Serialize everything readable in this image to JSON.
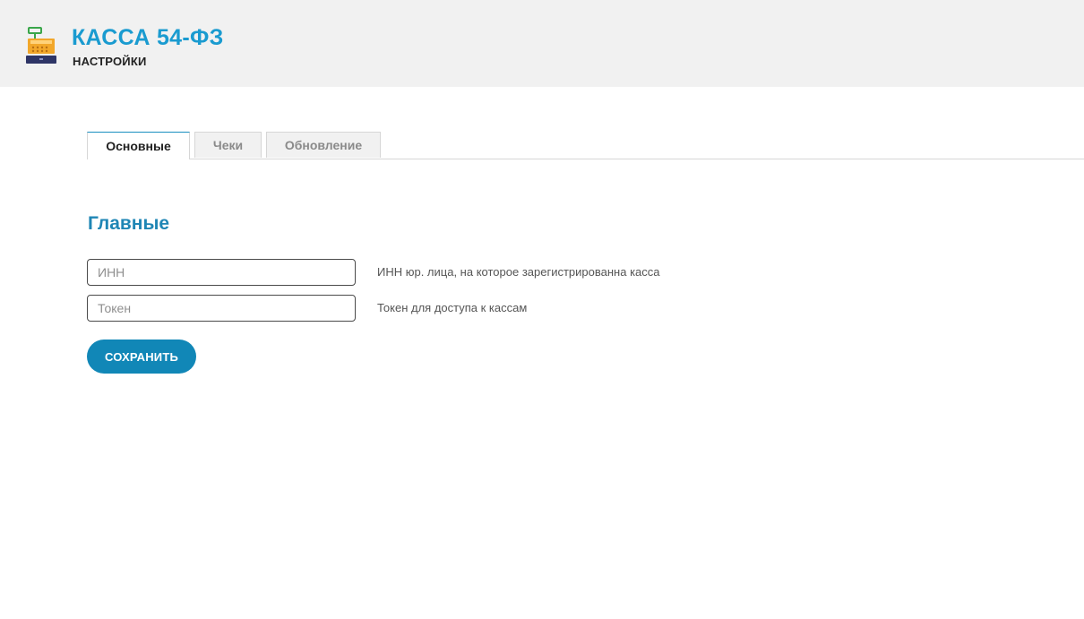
{
  "header": {
    "title": "КАССА 54-ФЗ",
    "subtitle": "НАСТРОЙКИ",
    "logo_icon": "cash-register-icon"
  },
  "tabs": [
    {
      "label": "Основные",
      "active": true
    },
    {
      "label": "Чеки",
      "active": false
    },
    {
      "label": "Обновление",
      "active": false
    }
  ],
  "section": {
    "title": "Главные"
  },
  "form": {
    "inn": {
      "placeholder": "ИНН",
      "value": "",
      "hint": "ИНН юр. лица, на которое зарегистрированна касса"
    },
    "token": {
      "placeholder": "Токен",
      "value": "",
      "hint": "Токен для доступа к кассам"
    },
    "save_label": "СОХРАНИТЬ"
  },
  "colors": {
    "brand": "#1a9bd0",
    "section_title": "#1f86b5",
    "button": "#1187b7",
    "header_bg": "#f1f1f1"
  }
}
